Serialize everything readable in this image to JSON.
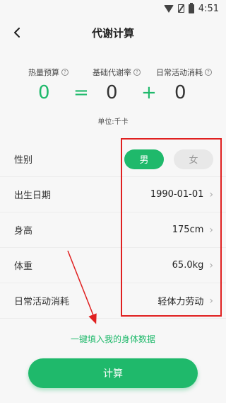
{
  "status_bar": {
    "time": "4:51"
  },
  "header": {
    "title": "代谢计算"
  },
  "summary": {
    "labels": {
      "calorie_budget": "热量预算",
      "basal_metabolism": "基础代谢率",
      "daily_activity": "日常活动消耗"
    },
    "values": {
      "calorie_budget": "0",
      "basal_metabolism": "0",
      "daily_activity": "0"
    },
    "ops": {
      "equals": "=",
      "plus": "+"
    },
    "unit": "单位:千卡"
  },
  "form": {
    "gender": {
      "label": "性别",
      "male": "男",
      "female": "女",
      "selected": "男"
    },
    "birth_date": {
      "label": "出生日期",
      "value": "1990-01-01"
    },
    "height": {
      "label": "身高",
      "value": "175cm"
    },
    "weight": {
      "label": "体重",
      "value": "65.0kg"
    },
    "activity": {
      "label": "日常活动消耗",
      "value": "轻体力劳动"
    }
  },
  "actions": {
    "fill_link": "一键填入我的身体数据",
    "calculate": "计算"
  },
  "colors": {
    "accent": "#1fb96b",
    "annotation": "#e02020"
  }
}
